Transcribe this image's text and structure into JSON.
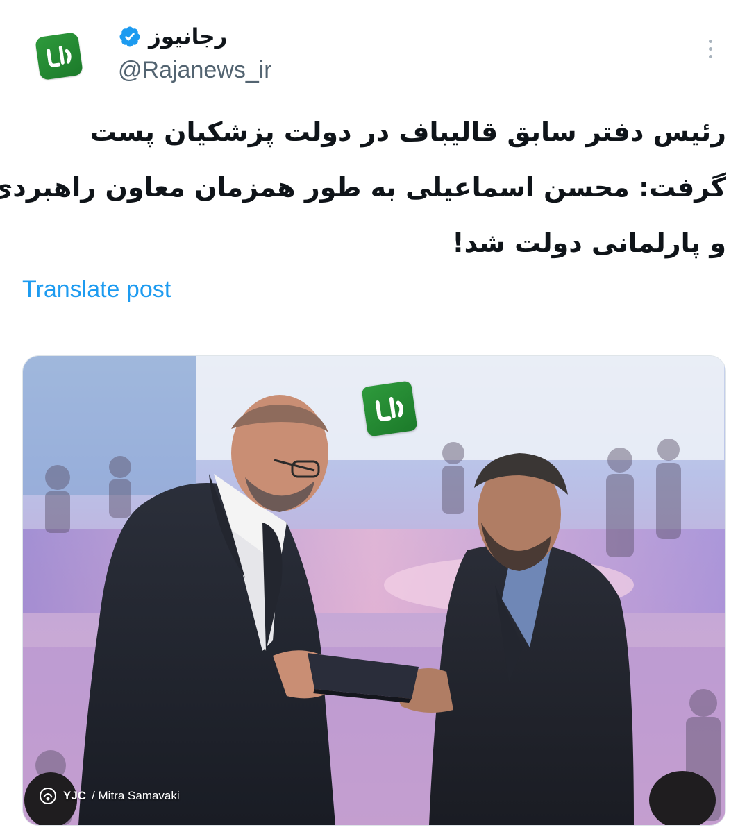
{
  "author": {
    "display_name": "رجانیوز",
    "handle": "@Rajanews_ir",
    "avatar_icon": "raja-logo-icon",
    "verified": true,
    "verified_color": "#1d9bf0"
  },
  "post": {
    "text_lines": [
      "رئیس دفتر سابق قالیباف در دولت پزشکیان پست",
      "گرفت: محسن اسماعیلی به طور همزمان معاون راهبردی",
      "و پارلمانی دولت شد!"
    ],
    "translate_label": "Translate post"
  },
  "media": {
    "watermark_icon": "raja-logo-icon",
    "credit_brand": "YJC",
    "credit_text": "/ Mitra Samavaki",
    "credit_icon": "yjc-logo-icon"
  },
  "menu": {
    "icon": "more-options-icon"
  },
  "colors": {
    "text": "#0f1419",
    "secondary": "#536471",
    "link": "#1d9bf0",
    "brand_green": "#1f8a30"
  }
}
